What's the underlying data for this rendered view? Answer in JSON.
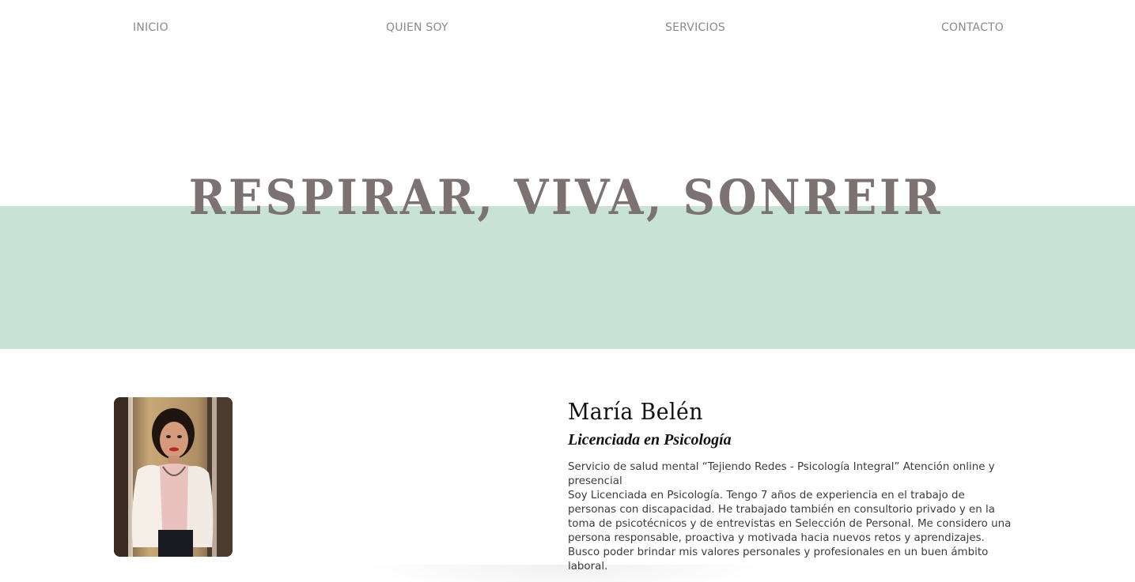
{
  "nav": {
    "items": [
      {
        "label": "INICIO"
      },
      {
        "label": "QUIEN SOY"
      },
      {
        "label": "SERVICIOS"
      },
      {
        "label": "CONTACTO"
      }
    ]
  },
  "hero": {
    "title": "RESPIRAR, VIVA, SONREIR",
    "band_color": "#c8e2d6",
    "title_color": "#7c7274"
  },
  "profile": {
    "photo_icon": "portrait-photo",
    "name": "María Belén",
    "degree": "Licenciada en Psicología",
    "paragraphs": [
      "Servicio de salud mental “Tejiendo Redes - Psicología Integral” Atención online y presencial",
      "Soy Licenciada en Psicología. Tengo 7 años de experiencia en el trabajo de personas con discapacidad. He trabajado también en consultorio privado y en la toma de psicotécnicos y de entrevistas en Selección de Personal. Me considero una persona responsable, proactiva y motivada hacia nuevos retos y aprendizajes. Busco poder brindar mis valores personales y profesionales en un buen ámbito laboral."
    ]
  }
}
